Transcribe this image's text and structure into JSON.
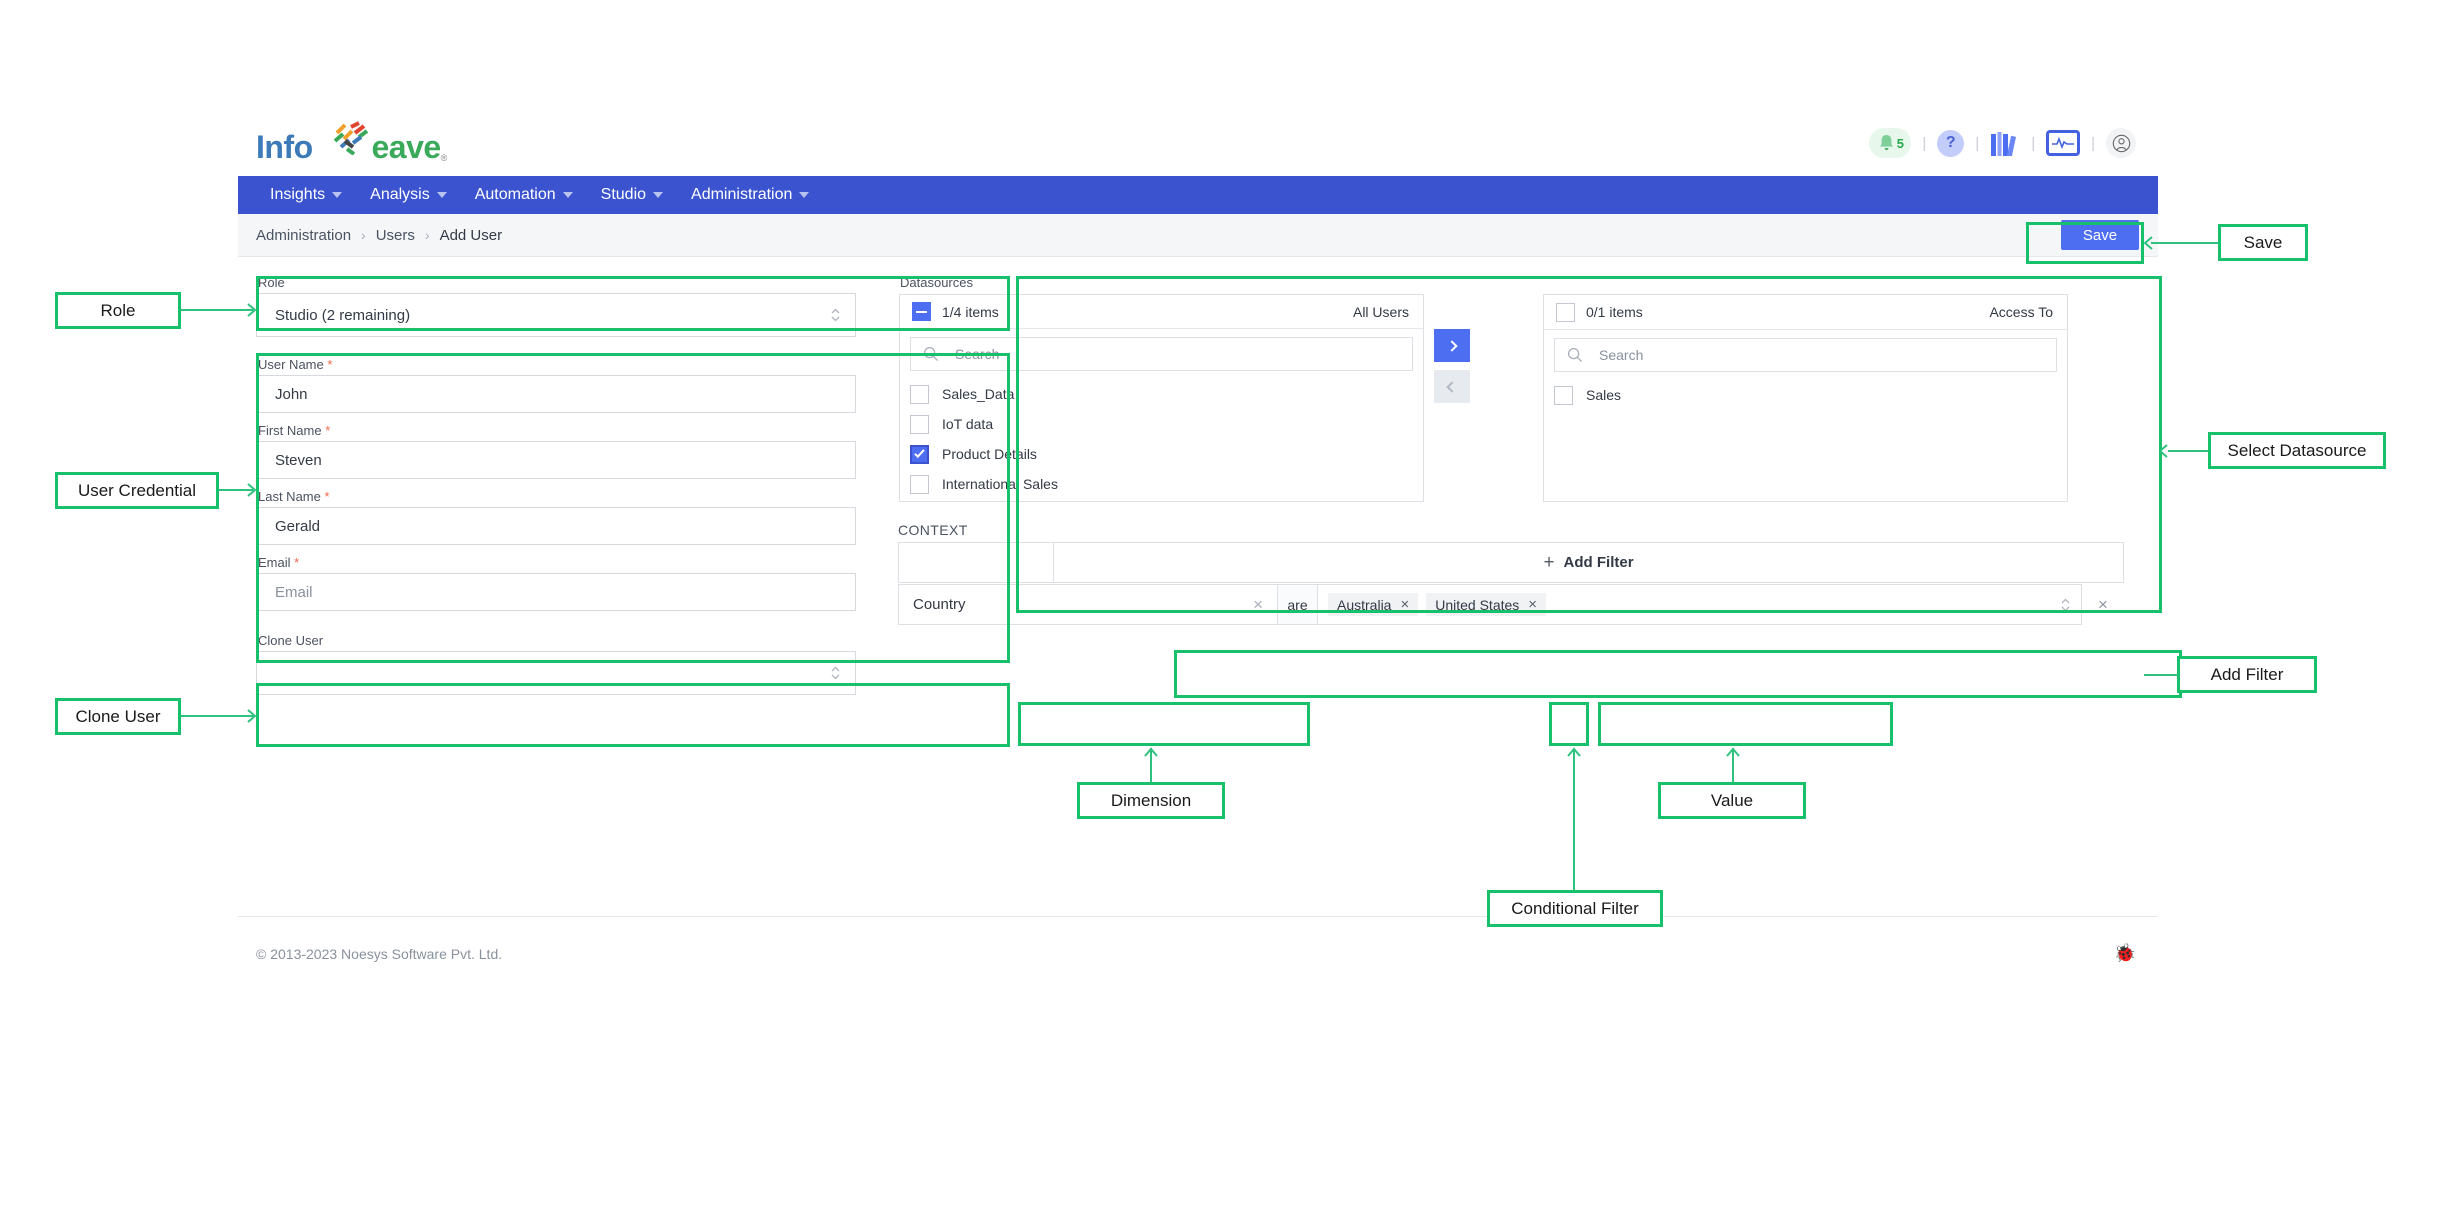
{
  "brand": {
    "name_part1": "Info",
    "name_part2": "eave",
    "registered": "®"
  },
  "topbar": {
    "notification_count": "5",
    "help_glyph": "?",
    "icons": [
      "bell-icon",
      "help-icon",
      "library-icon",
      "monitor-icon",
      "account-icon"
    ]
  },
  "nav": {
    "items": [
      {
        "label": "Insights"
      },
      {
        "label": "Analysis"
      },
      {
        "label": "Automation"
      },
      {
        "label": "Studio"
      },
      {
        "label": "Administration"
      }
    ]
  },
  "breadcrumb": {
    "items": [
      "Administration",
      "Users",
      "Add User"
    ],
    "separator": "›"
  },
  "toolbar": {
    "save_label": "Save"
  },
  "form": {
    "role": {
      "label": "Role",
      "value": "Studio (2 remaining)"
    },
    "user_name": {
      "label": "User Name",
      "required": "*",
      "value": "John"
    },
    "first_name": {
      "label": "First Name",
      "required": "*",
      "value": "Steven"
    },
    "last_name": {
      "label": "Last Name",
      "required": "*",
      "value": "Gerald"
    },
    "email": {
      "label": "Email",
      "required": "*",
      "value": "",
      "placeholder": "Email"
    },
    "clone_user": {
      "label": "Clone User",
      "value": ""
    }
  },
  "datasources": {
    "caption": "Datasources",
    "available": {
      "count": "1/4 items",
      "title": "All Users",
      "search_placeholder": "Search",
      "items": [
        {
          "label": "Sales_Data",
          "checked": false
        },
        {
          "label": "IoT data",
          "checked": false
        },
        {
          "label": "Product Details",
          "checked": true
        },
        {
          "label": "International Sales",
          "checked": false
        }
      ]
    },
    "assigned": {
      "count": "0/1 items",
      "title": "Access To",
      "search_placeholder": "Search",
      "items": [
        {
          "label": "Sales",
          "checked": false
        }
      ]
    },
    "transfer": {
      "right": "›",
      "left": "‹"
    }
  },
  "context": {
    "caption": "CONTEXT",
    "add_filter_label": "Add Filter",
    "add_filter_plus": "+",
    "filter": {
      "dimension": "Country",
      "dimension_clear": "×",
      "operator": "are",
      "values": [
        "Australia",
        "United States"
      ],
      "chip_remove": "×",
      "row_remove": "×"
    }
  },
  "footer": {
    "copyright": "© 2013-2023 Noesys Software Pvt. Ltd.",
    "bug_glyph": "🐞"
  },
  "annotations": {
    "role": "Role",
    "user_credential": "User Credential",
    "clone_user": "Clone User",
    "save": "Save",
    "select_datasource": "Select Datasource",
    "add_filter": "Add Filter",
    "dimension": "Dimension",
    "value": "Value",
    "conditional_filter": "Conditional Filter"
  },
  "colors": {
    "nav_blue": "#3b53ce",
    "accent_blue": "#4e6ef2",
    "annotation_green": "#17c06a",
    "required_red": "#f4664a"
  }
}
